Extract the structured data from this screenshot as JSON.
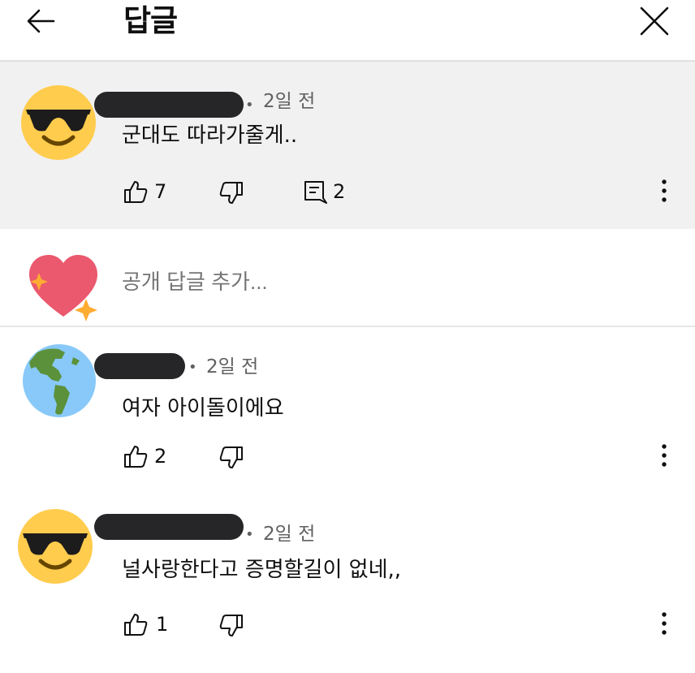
{
  "header": {
    "title": "답글",
    "back_icon": "arrow-left-icon",
    "close_icon": "close-x-icon"
  },
  "parent_comment": {
    "avatar": "sunglasses-emoji-avatar",
    "time": "2일 전",
    "text": "군대도 따라가줄게..",
    "likes": "7",
    "replies": "2"
  },
  "reply_box": {
    "avatar": "sparkling-heart-emoji-avatar",
    "placeholder": "공개 답글 추가..."
  },
  "replies": [
    {
      "avatar": "globe-americas-emoji-avatar",
      "time": "2일 전",
      "text": "여자 아이돌이에요",
      "likes": "2"
    },
    {
      "avatar": "sunglasses-emoji-avatar",
      "time": "2일 전",
      "text": "널사랑한다고 증명할길이 없네,,",
      "likes": "1"
    }
  ],
  "colors": {
    "highlight_bg": "#f1f1f1",
    "redaction": "#262629",
    "emoji_yellow": "#ffcc4d",
    "heart_pink": "#ea596e",
    "sparkle_yellow": "#ffac33",
    "globe_blue": "#88c9f9",
    "globe_green": "#5c913b"
  }
}
